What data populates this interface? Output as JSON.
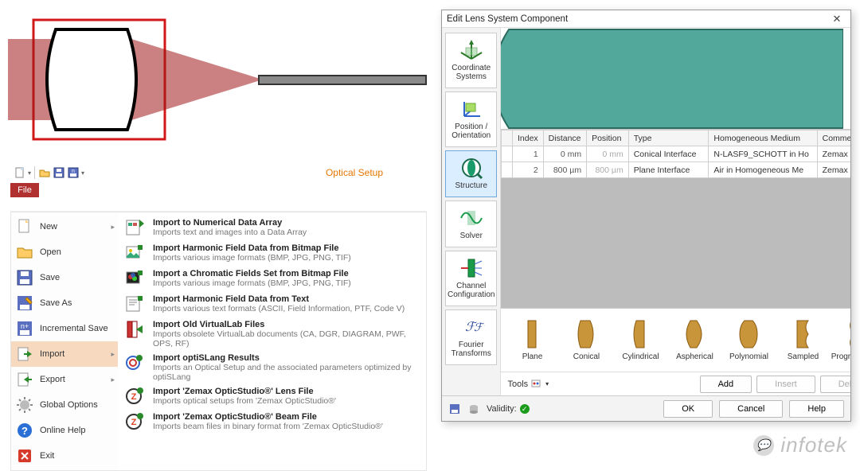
{
  "diagram": {
    "present": true
  },
  "filemenu": {
    "toolbar_title": "Optical Setup",
    "file_tab": "File",
    "left": [
      {
        "label": "New",
        "arrow": true
      },
      {
        "label": "Open"
      },
      {
        "label": "Save"
      },
      {
        "label": "Save As"
      },
      {
        "label": "Incremental Save"
      },
      {
        "label": "Import",
        "arrow": true,
        "selected": true
      },
      {
        "label": "Export",
        "arrow": true
      },
      {
        "label": "Global Options"
      },
      {
        "label": "Online Help"
      },
      {
        "label": "Exit"
      }
    ],
    "right": [
      {
        "title": "Import to Numerical Data Array",
        "desc": "Imports text and images into a Data Array"
      },
      {
        "title": "Import Harmonic Field Data from Bitmap File",
        "desc": "Imports various image formats (BMP, JPG, PNG, TIF)"
      },
      {
        "title": "Import a Chromatic Fields Set from Bitmap File",
        "desc": "Imports various image formats (BMP, JPG, PNG, TIF)"
      },
      {
        "title": "Import Harmonic Field Data from Text",
        "desc": "Imports various text formats (ASCII, Field Information, PTF, Code V)"
      },
      {
        "title": "Import Old VirtualLab Files",
        "desc": "Imports obsolete VirtualLab documents (CA, DGR, DIAGRAM, PWF, OPS, RF)"
      },
      {
        "title": "Import optiSLang Results",
        "desc": "Imports an Optical Setup and the associated parameters optimized by optiSLang"
      },
      {
        "title": "Import 'Zemax OpticStudio®' Lens File",
        "desc": "Imports optical setups from 'Zemax OpticStudio®'"
      },
      {
        "title": "Import 'Zemax OpticStudio®' Beam File",
        "desc": "Imports beam files in binary format from 'Zemax OpticStudio®'"
      }
    ]
  },
  "dialog": {
    "title": "Edit Lens System Component",
    "nav": [
      {
        "label": "Coordinate Systems"
      },
      {
        "label": "Position / Orientation"
      },
      {
        "label": "Structure",
        "selected": true
      },
      {
        "label": "Solver"
      },
      {
        "label": "Channel Configuration"
      },
      {
        "label": "Fourier Transforms"
      }
    ],
    "columns": [
      "",
      "Index",
      "Distance",
      "Position",
      "Type",
      "Homogeneous Medium",
      "Comment"
    ],
    "rows": [
      {
        "index": "1",
        "distance": "0 mm",
        "position": "0 mm",
        "type": "Conical Interface",
        "medium": "N-LASF9_SCHOTT in Ho",
        "comment": "Zemax Interface"
      },
      {
        "index": "2",
        "distance": "800 µm",
        "position": "800 µm",
        "type": "Plane Interface",
        "medium": "Air in Homogeneous Me",
        "comment": "Zemax Interface"
      }
    ],
    "types": [
      "Plane",
      "Conical",
      "Cylindrical",
      "Aspherical",
      "Polynomial",
      "Sampled",
      "Programmable"
    ],
    "tools_label": "Tools",
    "buttons": {
      "add": "Add",
      "insert": "Insert",
      "delete": "Delete",
      "ok": "OK",
      "cancel": "Cancel",
      "help": "Help"
    },
    "validity_label": "Validity:"
  },
  "watermark": "infotek"
}
